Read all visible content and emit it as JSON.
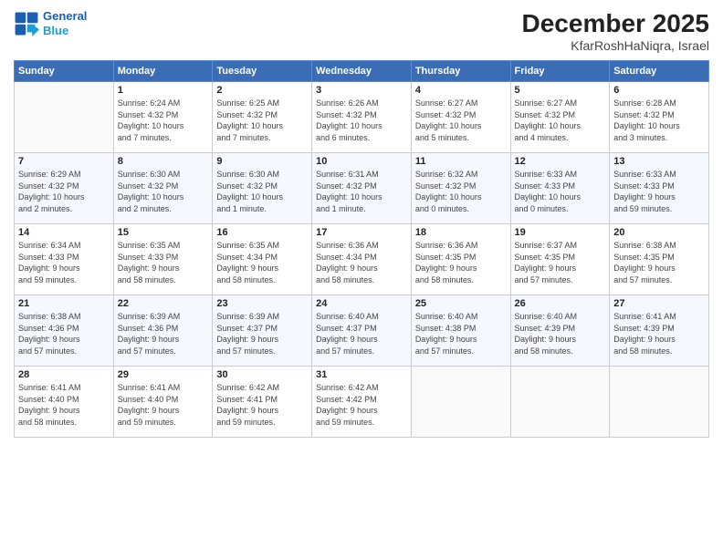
{
  "header": {
    "logo_line1": "General",
    "logo_line2": "Blue",
    "month": "December 2025",
    "location": "KfarRoshHaNiqra, Israel"
  },
  "weekdays": [
    "Sunday",
    "Monday",
    "Tuesday",
    "Wednesday",
    "Thursday",
    "Friday",
    "Saturday"
  ],
  "weeks": [
    [
      {
        "day": "",
        "info": ""
      },
      {
        "day": "1",
        "info": "Sunrise: 6:24 AM\nSunset: 4:32 PM\nDaylight: 10 hours\nand 7 minutes."
      },
      {
        "day": "2",
        "info": "Sunrise: 6:25 AM\nSunset: 4:32 PM\nDaylight: 10 hours\nand 7 minutes."
      },
      {
        "day": "3",
        "info": "Sunrise: 6:26 AM\nSunset: 4:32 PM\nDaylight: 10 hours\nand 6 minutes."
      },
      {
        "day": "4",
        "info": "Sunrise: 6:27 AM\nSunset: 4:32 PM\nDaylight: 10 hours\nand 5 minutes."
      },
      {
        "day": "5",
        "info": "Sunrise: 6:27 AM\nSunset: 4:32 PM\nDaylight: 10 hours\nand 4 minutes."
      },
      {
        "day": "6",
        "info": "Sunrise: 6:28 AM\nSunset: 4:32 PM\nDaylight: 10 hours\nand 3 minutes."
      }
    ],
    [
      {
        "day": "7",
        "info": "Sunrise: 6:29 AM\nSunset: 4:32 PM\nDaylight: 10 hours\nand 2 minutes."
      },
      {
        "day": "8",
        "info": "Sunrise: 6:30 AM\nSunset: 4:32 PM\nDaylight: 10 hours\nand 2 minutes."
      },
      {
        "day": "9",
        "info": "Sunrise: 6:30 AM\nSunset: 4:32 PM\nDaylight: 10 hours\nand 1 minute."
      },
      {
        "day": "10",
        "info": "Sunrise: 6:31 AM\nSunset: 4:32 PM\nDaylight: 10 hours\nand 1 minute."
      },
      {
        "day": "11",
        "info": "Sunrise: 6:32 AM\nSunset: 4:32 PM\nDaylight: 10 hours\nand 0 minutes."
      },
      {
        "day": "12",
        "info": "Sunrise: 6:33 AM\nSunset: 4:33 PM\nDaylight: 10 hours\nand 0 minutes."
      },
      {
        "day": "13",
        "info": "Sunrise: 6:33 AM\nSunset: 4:33 PM\nDaylight: 9 hours\nand 59 minutes."
      }
    ],
    [
      {
        "day": "14",
        "info": "Sunrise: 6:34 AM\nSunset: 4:33 PM\nDaylight: 9 hours\nand 59 minutes."
      },
      {
        "day": "15",
        "info": "Sunrise: 6:35 AM\nSunset: 4:33 PM\nDaylight: 9 hours\nand 58 minutes."
      },
      {
        "day": "16",
        "info": "Sunrise: 6:35 AM\nSunset: 4:34 PM\nDaylight: 9 hours\nand 58 minutes."
      },
      {
        "day": "17",
        "info": "Sunrise: 6:36 AM\nSunset: 4:34 PM\nDaylight: 9 hours\nand 58 minutes."
      },
      {
        "day": "18",
        "info": "Sunrise: 6:36 AM\nSunset: 4:35 PM\nDaylight: 9 hours\nand 58 minutes."
      },
      {
        "day": "19",
        "info": "Sunrise: 6:37 AM\nSunset: 4:35 PM\nDaylight: 9 hours\nand 57 minutes."
      },
      {
        "day": "20",
        "info": "Sunrise: 6:38 AM\nSunset: 4:35 PM\nDaylight: 9 hours\nand 57 minutes."
      }
    ],
    [
      {
        "day": "21",
        "info": "Sunrise: 6:38 AM\nSunset: 4:36 PM\nDaylight: 9 hours\nand 57 minutes."
      },
      {
        "day": "22",
        "info": "Sunrise: 6:39 AM\nSunset: 4:36 PM\nDaylight: 9 hours\nand 57 minutes."
      },
      {
        "day": "23",
        "info": "Sunrise: 6:39 AM\nSunset: 4:37 PM\nDaylight: 9 hours\nand 57 minutes."
      },
      {
        "day": "24",
        "info": "Sunrise: 6:40 AM\nSunset: 4:37 PM\nDaylight: 9 hours\nand 57 minutes."
      },
      {
        "day": "25",
        "info": "Sunrise: 6:40 AM\nSunset: 4:38 PM\nDaylight: 9 hours\nand 57 minutes."
      },
      {
        "day": "26",
        "info": "Sunrise: 6:40 AM\nSunset: 4:39 PM\nDaylight: 9 hours\nand 58 minutes."
      },
      {
        "day": "27",
        "info": "Sunrise: 6:41 AM\nSunset: 4:39 PM\nDaylight: 9 hours\nand 58 minutes."
      }
    ],
    [
      {
        "day": "28",
        "info": "Sunrise: 6:41 AM\nSunset: 4:40 PM\nDaylight: 9 hours\nand 58 minutes."
      },
      {
        "day": "29",
        "info": "Sunrise: 6:41 AM\nSunset: 4:40 PM\nDaylight: 9 hours\nand 59 minutes."
      },
      {
        "day": "30",
        "info": "Sunrise: 6:42 AM\nSunset: 4:41 PM\nDaylight: 9 hours\nand 59 minutes."
      },
      {
        "day": "31",
        "info": "Sunrise: 6:42 AM\nSunset: 4:42 PM\nDaylight: 9 hours\nand 59 minutes."
      },
      {
        "day": "",
        "info": ""
      },
      {
        "day": "",
        "info": ""
      },
      {
        "day": "",
        "info": ""
      }
    ]
  ]
}
